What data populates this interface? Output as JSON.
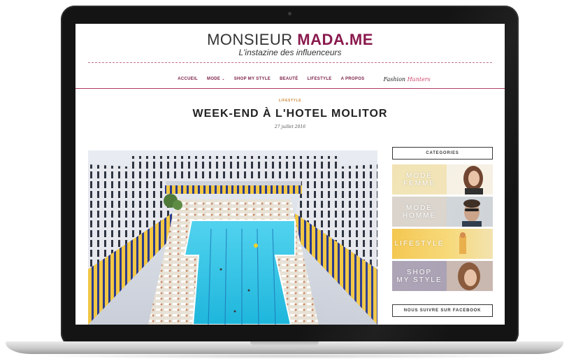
{
  "site": {
    "brand_plain": "MONSIEUR ",
    "brand_bold": "MADA.ME",
    "tagline": "L'instazine des influenceurs"
  },
  "nav": {
    "items": [
      {
        "label": "ACCUEIL"
      },
      {
        "label": "MODE"
      },
      {
        "label": "SHOP MY STYLE"
      },
      {
        "label": "BEAUTÉ"
      },
      {
        "label": "LIFESTYLE"
      },
      {
        "label": "A PROPOS"
      }
    ],
    "dropdown_icon": "chevron-down-icon",
    "partner_logo_part1": "Fashion ",
    "partner_logo_part2": "Hunters"
  },
  "post": {
    "category": "LIFESTYLE",
    "title": "WEEK-END À L'HOTEL MOLITOR",
    "date": "27 juillet 2016"
  },
  "sidebar": {
    "categories_title": "CATEGORIES",
    "categories": [
      {
        "line1": "MODE",
        "line2": "FEMME"
      },
      {
        "line1": "MODE",
        "line2": "HOMME"
      },
      {
        "line1": "LIFESTYLE",
        "line2": ""
      },
      {
        "line1": "SHOP",
        "line2": "MY STYLE"
      }
    ],
    "facebook_title": "NOUS SUIVRE SUR FACEBOOK"
  },
  "colors": {
    "brand": "#8a1a4d",
    "nav": "#7a1d45",
    "category_label": "#c9893a",
    "pool": "#3fc6e6"
  }
}
